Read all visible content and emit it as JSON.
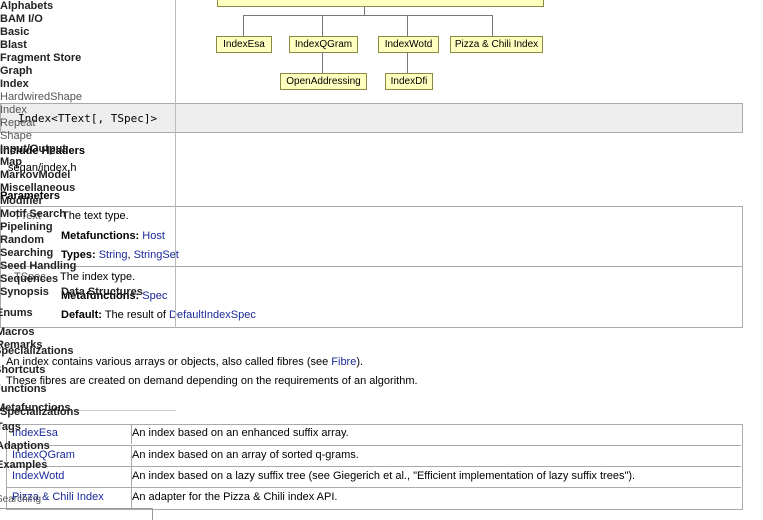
{
  "diagram": {
    "row1": [
      "IndexEsa",
      "IndexQGram",
      "IndexWotd",
      "Pizza & Chili Index"
    ],
    "row2": [
      "OpenAddressing",
      "IndexDfi"
    ]
  },
  "signature": "Index<TText[, TSpec]>",
  "include_headers_title": "Include Headers",
  "include_path": "seqan/index.h",
  "parameters_title": "Parameters",
  "params": [
    {
      "name": "TText",
      "desc": "The text type.",
      "metafunctions_label": "Metafunctions:",
      "metafunctions": [
        "Host"
      ],
      "types_label": "Types:",
      "types": [
        "String",
        "StringSet"
      ],
      "types_sep": ","
    },
    {
      "name": "TSpec",
      "desc": "The index type.",
      "metafunctions_label": "Metafunctions:",
      "metafunctions": [
        "Spec"
      ],
      "default_label": "Default:",
      "default_text": "The result of",
      "default_link": "DefaultIndexSpec"
    }
  ],
  "remarks": {
    "line1_prefix": "An index contains various arrays or objects, also called fibres (see",
    "line1_link": "Fibre",
    "line1_suffix": ").",
    "line2": "These fibres are created on demand depending on the requirements of an algorithm."
  },
  "spec_table": [
    {
      "name": "IndexEsa",
      "desc": "An index based on an enhanced suffix array."
    },
    {
      "name": "IndexQGram",
      "desc": "An index based on an array of sorted q-grams."
    },
    {
      "name": "IndexWotd",
      "desc": "An index based on a lazy suffix tree (see Giegerich et al., \"Efficient implementation of lazy suffix trees\")."
    },
    {
      "name": "Pizza & Chili Index",
      "desc": "An adapter for the Pizza & Chili index API."
    }
  ],
  "sidebar": {
    "categories": [
      "Alphabets",
      "BAM I/O",
      "Basic",
      "Blast",
      "Fragment Store",
      "Graph",
      "Index"
    ],
    "index_items": [
      "HardwiredShape",
      "Index",
      "Repeat",
      "Shape"
    ],
    "categories2": [
      "Input/Output",
      "Map",
      "MarkovModel",
      "Miscellaneous",
      "Modifier",
      "Motif Search",
      "Pipelining",
      "Random",
      "Searching",
      "Seed Handling",
      "Sequences",
      "Synopsis",
      "Data Structures"
    ],
    "sections": [
      "Enums",
      "Macros",
      "Remarks",
      "Specializations",
      "Shortcuts",
      "Functions",
      "Metafunctions",
      "Specializations",
      "Tags",
      "Adaptions",
      "Examples",
      "Searching"
    ]
  }
}
